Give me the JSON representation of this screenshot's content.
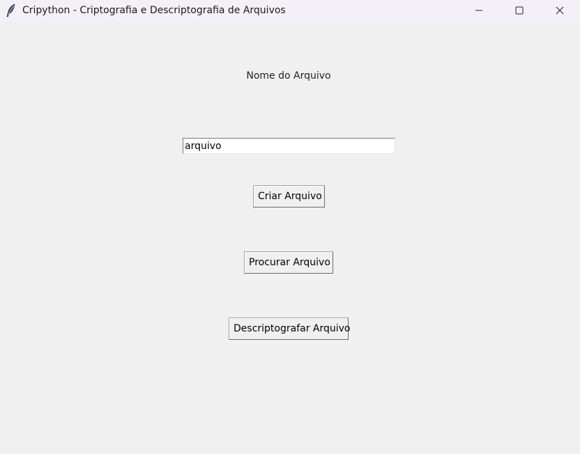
{
  "window": {
    "title": "Cripython - Criptografia e Descriptografia de Arquivos",
    "icon": "feather-icon",
    "controls": {
      "minimize": "minimize-icon",
      "maximize": "maximize-icon",
      "close": "close-icon"
    }
  },
  "form": {
    "label": "Nome do Arquivo",
    "entry_value": "arquivo"
  },
  "buttons": {
    "create": "Criar Arquivo",
    "browse": "Procurar Arquivo",
    "decrypt": "Descriptografar Arquivo"
  },
  "colors": {
    "background": "#f0f0f0",
    "titlebar": "#f3f0f7",
    "entry_background": "#ffffff"
  }
}
